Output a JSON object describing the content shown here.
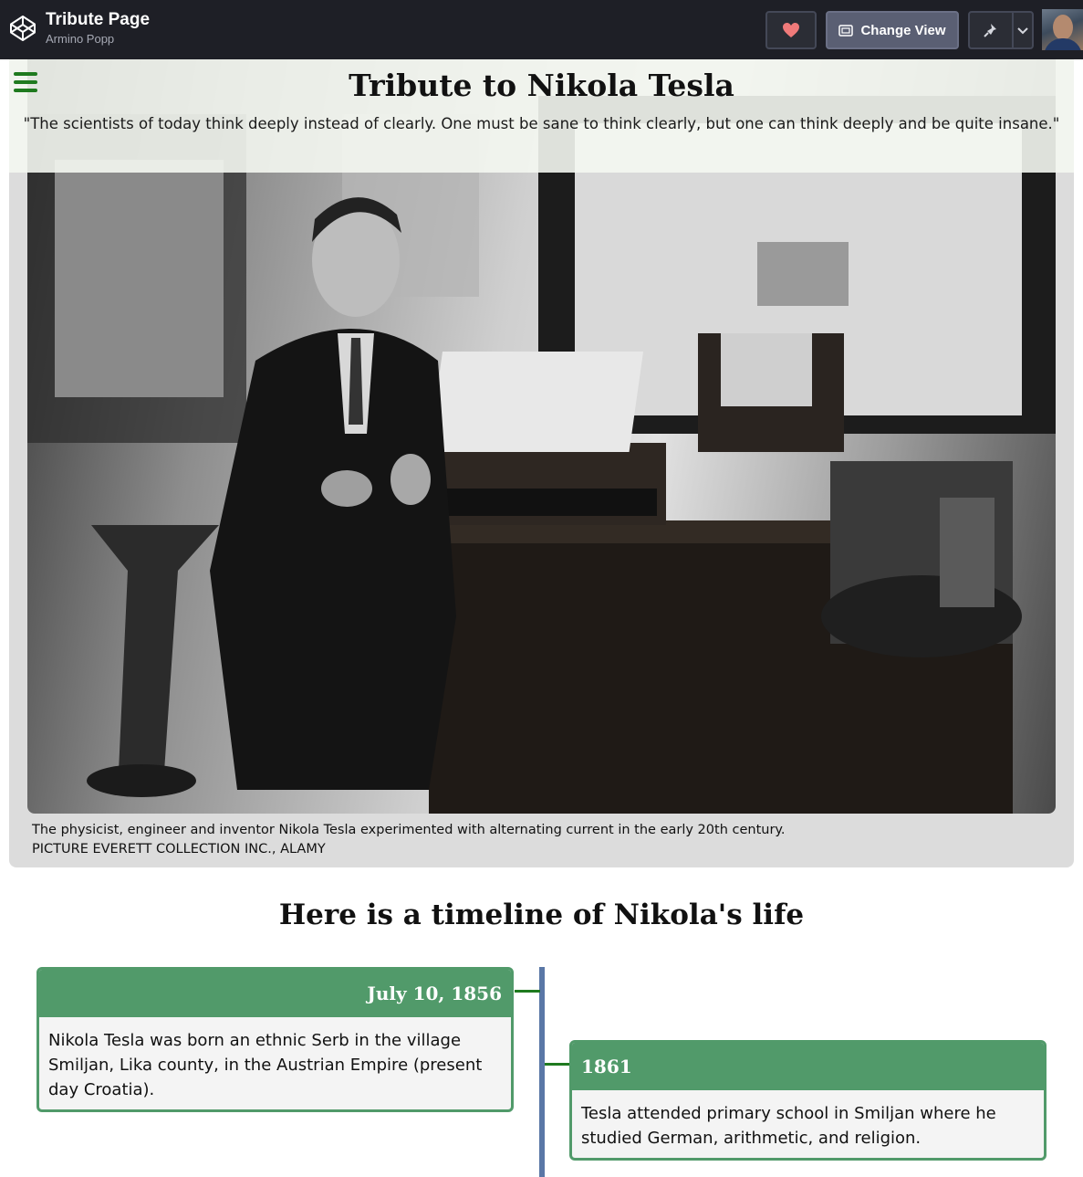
{
  "topbar": {
    "pen_title": "Tribute Page",
    "author": "Armino Popp",
    "change_view_label": "Change View",
    "icons": [
      "codepen-logo-icon",
      "heart-icon",
      "change-view-icon",
      "pin-icon",
      "chevron-down-icon"
    ],
    "heart_color": "#f07a7a"
  },
  "hero": {
    "title": "Tribute to Nikola Tesla",
    "quote": "\"The scientists of today think deeply instead of clearly. One must be sane to think clearly, but one can think deeply and be quite insane.\"",
    "caption_line1": "The physicist, engineer and inventor Nikola Tesla experimented with alternating current in the early 20th century.",
    "caption_line2": "PICTURE EVERETT COLLECTION INC., ALAMY"
  },
  "timeline": {
    "heading": "Here is a timeline of Nikola's life",
    "events": [
      {
        "date": "July 10, 1856",
        "text": "Nikola Tesla was born an ethnic Serb in the village Smiljan, Lika county, in the Austrian Empire (present day Croatia)."
      },
      {
        "date": "1861",
        "text": "Tesla attended primary school in Smiljan where he studied German, arithmetic, and religion."
      }
    ]
  },
  "colors": {
    "topbar_bg": "#1e1f26",
    "accent_green": "#519a6a",
    "timeline_axis": "#5a77a6",
    "menu_green": "#1f7a1f"
  }
}
